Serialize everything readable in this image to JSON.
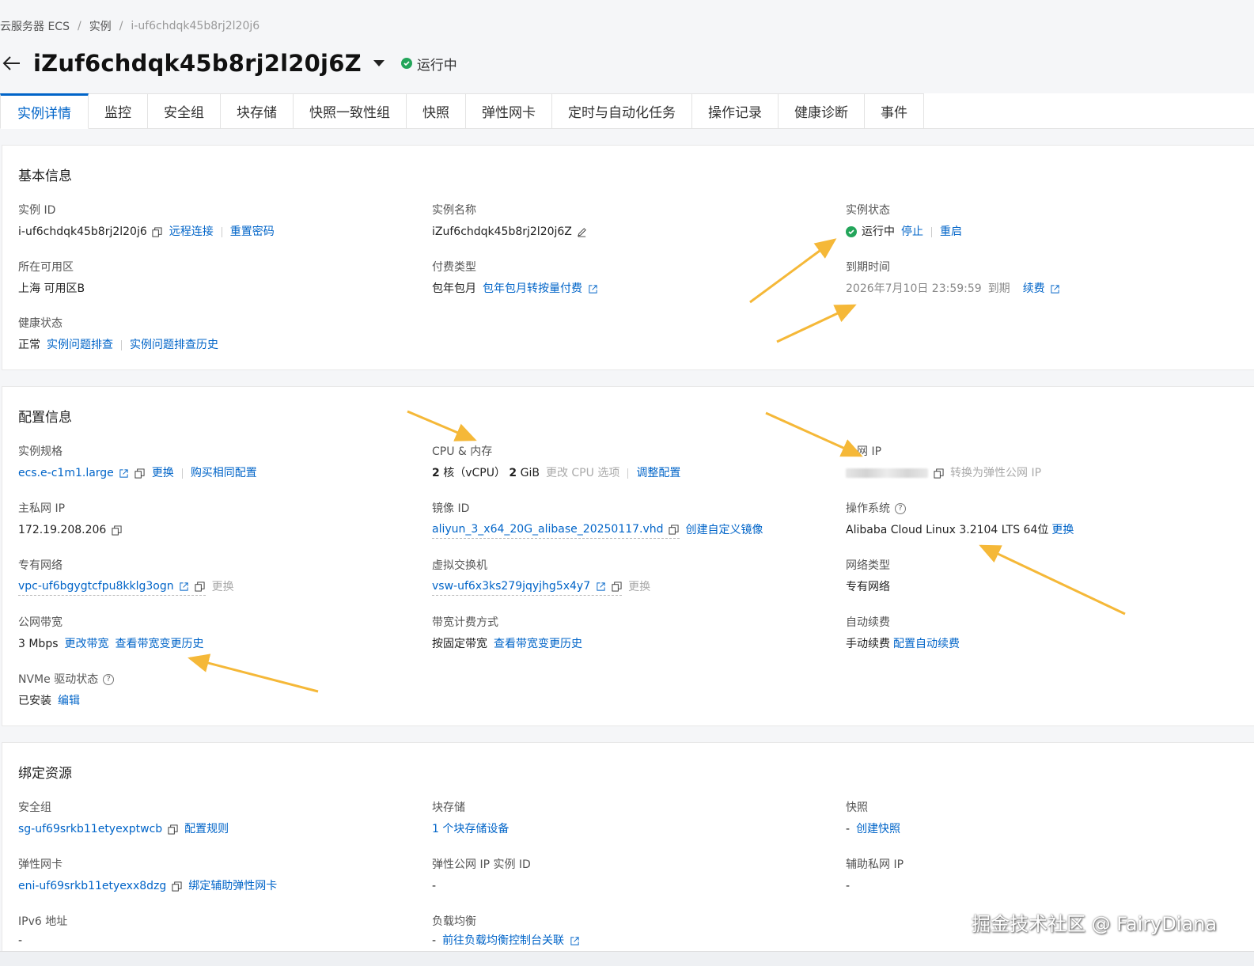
{
  "breadcrumb": [
    "云服务器 ECS",
    "实例",
    "i-uf6chdqk45b8rj2l20j6"
  ],
  "title": "iZuf6chdqk45b8rj2l20j6Z",
  "status": "运行中",
  "tabs": [
    "实例详情",
    "监控",
    "安全组",
    "块存储",
    "快照一致性组",
    "快照",
    "弹性网卡",
    "定时与自动化任务",
    "操作记录",
    "健康诊断",
    "事件"
  ],
  "basic": {
    "title": "基本信息",
    "instance_id": {
      "label": "实例 ID",
      "value": "i-uf6chdqk45b8rj2l20j6",
      "link1": "远程连接",
      "link2": "重置密码"
    },
    "instance_name": {
      "label": "实例名称",
      "value": "iZuf6chdqk45b8rj2l20j6Z"
    },
    "instance_status": {
      "label": "实例状态",
      "value": "运行中",
      "link1": "停止",
      "link2": "重启"
    },
    "zone": {
      "label": "所在可用区",
      "value": "上海 可用区B"
    },
    "billing": {
      "label": "付费类型",
      "value": "包年包月",
      "link": "包年包月转按量付费"
    },
    "expire": {
      "label": "到期时间",
      "value": "2026年7月10日 23:59:59",
      "suffix": "到期",
      "link": "续费"
    },
    "health": {
      "label": "健康状态",
      "value": "正常",
      "link1": "实例问题排查",
      "link2": "实例问题排查历史"
    }
  },
  "config": {
    "title": "配置信息",
    "spec": {
      "label": "实例规格",
      "value": "ecs.e-c1m1.large",
      "link1": "更换",
      "link2": "购买相同配置"
    },
    "cpu": {
      "label": "CPU & 内存",
      "cores": "2",
      "core_unit": "核（vCPU）",
      "mem": "2",
      "mem_unit": "GiB",
      "disabled": "更改 CPU 选项",
      "link": "调整配置"
    },
    "public_ip": {
      "label": "公网 IP",
      "disabled": "转换为弹性公网 IP"
    },
    "private_ip": {
      "label": "主私网 IP",
      "value": "172.19.208.206"
    },
    "image": {
      "label": "镜像 ID",
      "value": "aliyun_3_x64_20G_alibase_20250117.vhd",
      "link": "创建自定义镜像"
    },
    "os": {
      "label": "操作系统",
      "value": "Alibaba Cloud Linux 3.2104 LTS 64位",
      "link": "更换"
    },
    "vpc": {
      "label": "专有网络",
      "value": "vpc-uf6bgygtcfpu8kklg3ogn",
      "disabled": "更换"
    },
    "vswitch": {
      "label": "虚拟交换机",
      "value": "vsw-uf6x3ks279jqyjhg5x4y7",
      "disabled": "更换"
    },
    "net_type": {
      "label": "网络类型",
      "value": "专有网络"
    },
    "bandwidth": {
      "label": "公网带宽",
      "value": "3 Mbps",
      "link1": "更改带宽",
      "link2": "查看带宽变更历史"
    },
    "bw_billing": {
      "label": "带宽计费方式",
      "value": "按固定带宽",
      "link": "查看带宽变更历史"
    },
    "auto_renew": {
      "label": "自动续费",
      "value": "手动续费",
      "link": "配置自动续费"
    },
    "nvme": {
      "label": "NVMe 驱动状态",
      "value": "已安装",
      "link": "编辑"
    }
  },
  "bound": {
    "title": "绑定资源",
    "sg": {
      "label": "安全组",
      "value": "sg-uf69srkb11etyexptwcb",
      "link": "配置规则"
    },
    "disk": {
      "label": "块存储",
      "link": "1 个块存储设备"
    },
    "snapshot": {
      "label": "快照",
      "value": "-",
      "link": "创建快照"
    },
    "eni": {
      "label": "弹性网卡",
      "value": "eni-uf69srkb11etyexx8dzg",
      "link": "绑定辅助弹性网卡"
    },
    "eip": {
      "label": "弹性公网 IP 实例 ID",
      "value": "-"
    },
    "secondary_ip": {
      "label": "辅助私网 IP",
      "value": "-"
    },
    "ipv6": {
      "label": "IPv6 地址",
      "value": "-"
    },
    "slb": {
      "label": "负载均衡",
      "value": "-",
      "link": "前往负载均衡控制台关联"
    }
  },
  "watermark": "掘金技术社区 @ FairyDiana",
  "colors": {
    "link": "#0064c8",
    "running": "#23a55a",
    "arrow": "#f5b838"
  }
}
